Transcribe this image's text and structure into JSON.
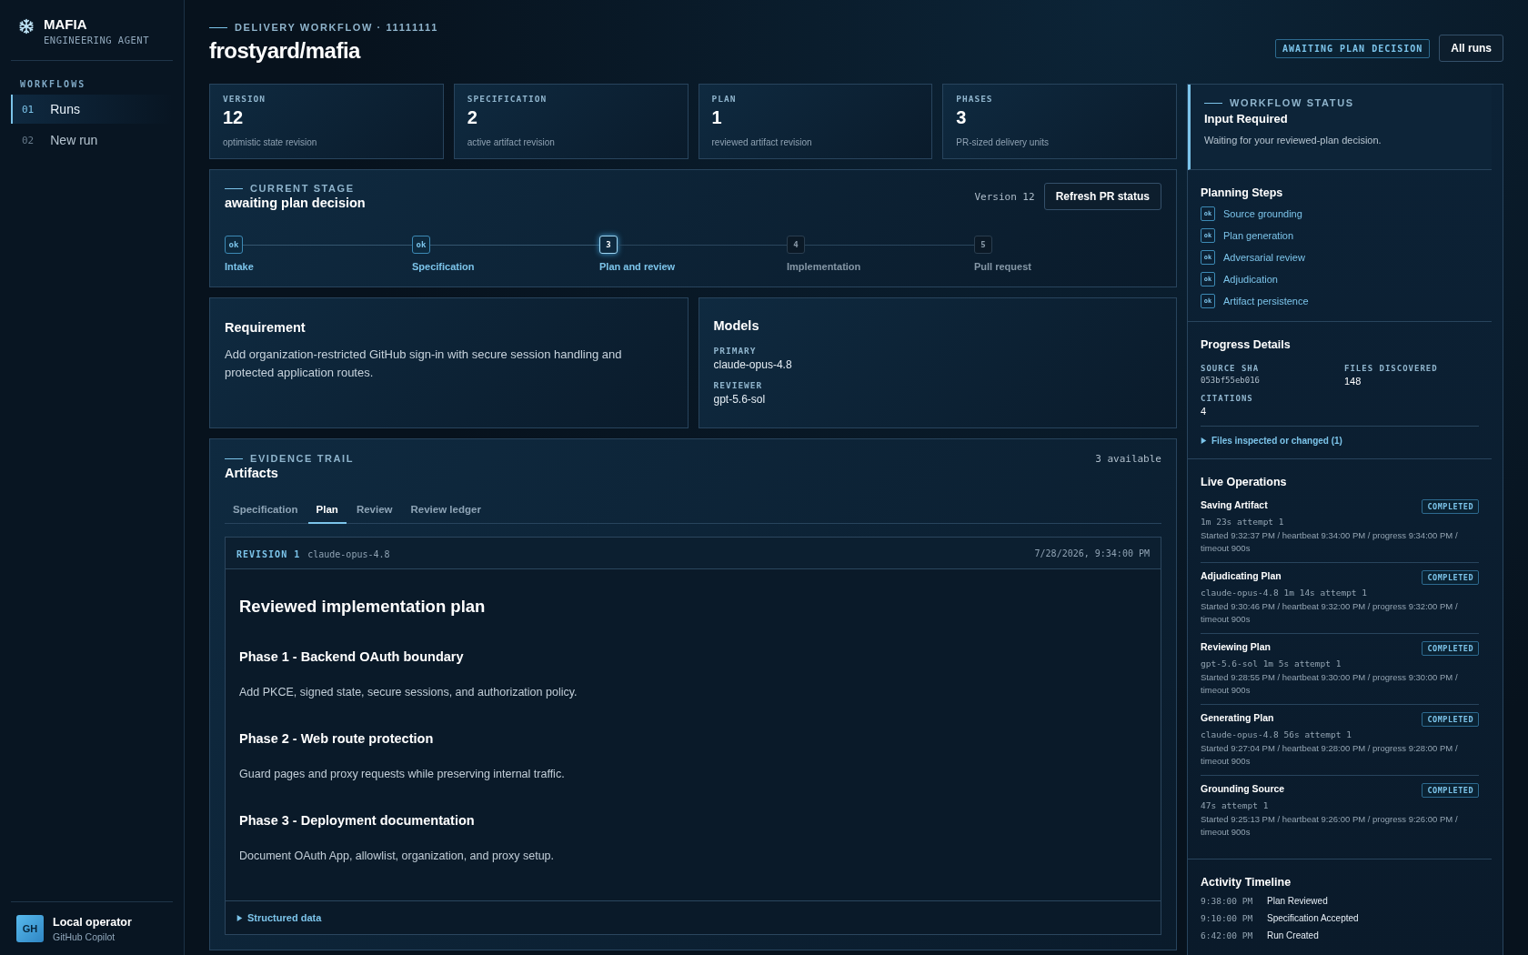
{
  "brand": {
    "name": "MAFIA",
    "subtitle": "ENGINEERING AGENT"
  },
  "sidebar": {
    "section": "WORKFLOWS",
    "items": [
      {
        "number": "01",
        "label": "Runs",
        "selected": true
      },
      {
        "number": "02",
        "label": "New run",
        "selected": false
      }
    ],
    "user": {
      "initials": "GH",
      "name": "Local operator",
      "subtitle": "GitHub Copilot"
    }
  },
  "header": {
    "eyebrow": "DELIVERY WORKFLOW · 11111111",
    "title": "frostyard/mafia",
    "status_badge": "AWAITING PLAN DECISION",
    "button": "All runs"
  },
  "stats": [
    {
      "label": "VERSION",
      "value": "12",
      "caption": "optimistic state revision"
    },
    {
      "label": "SPECIFICATION",
      "value": "2",
      "caption": "active artifact revision"
    },
    {
      "label": "PLAN",
      "value": "1",
      "caption": "reviewed artifact revision"
    },
    {
      "label": "PHASES",
      "value": "3",
      "caption": "PR-sized delivery units"
    }
  ],
  "stage": {
    "eyebrow": "CURRENT STAGE",
    "title": "awaiting plan decision",
    "version": "Version 12",
    "button": "Refresh PR status",
    "steps": [
      {
        "marker": "ok",
        "label": "Intake",
        "completed": true,
        "current": false
      },
      {
        "marker": "ok",
        "label": "Specification",
        "completed": true,
        "current": false
      },
      {
        "marker": "3",
        "label": "Plan and review",
        "completed": false,
        "current": true
      },
      {
        "marker": "4",
        "label": "Implementation",
        "completed": false,
        "current": false
      },
      {
        "marker": "5",
        "label": "Pull request",
        "completed": false,
        "current": false
      }
    ]
  },
  "requirement": {
    "title": "Requirement",
    "text": "Add organization-restricted GitHub sign-in with secure session handling and protected application routes."
  },
  "models": {
    "title": "Models",
    "entries": [
      {
        "label": "PRIMARY",
        "value": "claude-opus-4.8"
      },
      {
        "label": "REVIEWER",
        "value": "gpt-5.6-sol"
      }
    ]
  },
  "artifacts": {
    "eyebrow": "EVIDENCE TRAIL",
    "title": "Artifacts",
    "count": "3 available",
    "tabs": [
      {
        "label": "Specification",
        "selected": false
      },
      {
        "label": "Plan",
        "selected": true
      },
      {
        "label": "Review",
        "selected": false
      },
      {
        "label": "Review ledger",
        "selected": false
      }
    ],
    "revision": {
      "label": "REVISION 1",
      "model": "claude-opus-4.8",
      "date": "7/28/2026, 9:34:00 PM"
    },
    "document": {
      "title": "Reviewed implementation plan",
      "sections": [
        {
          "heading": "Phase 1 - Backend OAuth boundary",
          "text": "Add PKCE, signed state, secure sessions, and authorization policy."
        },
        {
          "heading": "Phase 2 - Web route protection",
          "text": "Guard pages and proxy requests while preserving internal traffic."
        },
        {
          "heading": "Phase 3 - Deployment documentation",
          "text": "Document OAuth App, allowlist, organization, and proxy setup."
        }
      ]
    },
    "structured_data": {
      "label": "Structured data",
      "expanded": false
    }
  },
  "workflow_status": {
    "eyebrow": "WORKFLOW STATUS",
    "title": "Input Required",
    "text": "Waiting for your reviewed-plan decision."
  },
  "planning_steps": {
    "title": "Planning Steps",
    "items": [
      {
        "marker": "ok",
        "label": "Source grounding"
      },
      {
        "marker": "ok",
        "label": "Plan generation"
      },
      {
        "marker": "ok",
        "label": "Adversarial review"
      },
      {
        "marker": "ok",
        "label": "Adjudication"
      },
      {
        "marker": "ok",
        "label": "Artifact persistence"
      }
    ]
  },
  "progress_details": {
    "title": "Progress Details",
    "fields": [
      {
        "label": "SOURCE SHA",
        "value": "053bf55eb016",
        "kind": "mono"
      },
      {
        "label": "FILES DISCOVERED",
        "value": "148",
        "kind": "text"
      },
      {
        "label": "CITATIONS",
        "value": "4",
        "kind": "text"
      }
    ],
    "files": {
      "label": "Files inspected or changed (1)",
      "expanded": false
    }
  },
  "live_operations": {
    "title": "Live Operations",
    "items": [
      {
        "name": "Saving Artifact",
        "status": "COMPLETED",
        "meta": "1m 23s attempt 1",
        "detail": "Started 9:32:37 PM / heartbeat 9:34:00 PM / progress 9:34:00 PM / timeout 900s"
      },
      {
        "name": "Adjudicating Plan",
        "status": "COMPLETED",
        "meta": "claude-opus-4.8 1m 14s attempt 1",
        "detail": "Started 9:30:46 PM / heartbeat 9:32:00 PM / progress 9:32:00 PM / timeout 900s"
      },
      {
        "name": "Reviewing Plan",
        "status": "COMPLETED",
        "meta": "gpt-5.6-sol 1m 5s attempt 1",
        "detail": "Started 9:28:55 PM / heartbeat 9:30:00 PM / progress 9:30:00 PM / timeout 900s"
      },
      {
        "name": "Generating Plan",
        "status": "COMPLETED",
        "meta": "claude-opus-4.8 56s attempt 1",
        "detail": "Started 9:27:04 PM / heartbeat 9:28:00 PM / progress 9:28:00 PM / timeout 900s"
      },
      {
        "name": "Grounding Source",
        "status": "COMPLETED",
        "meta": "47s attempt 1",
        "detail": "Started 9:25:13 PM / heartbeat 9:26:00 PM / progress 9:26:00 PM / timeout 900s"
      }
    ]
  },
  "activity_timeline": {
    "title": "Activity Timeline",
    "items": [
      {
        "time": "9:38:00 PM",
        "event": "Plan Reviewed"
      },
      {
        "time": "9:10:00 PM",
        "event": "Specification Accepted"
      },
      {
        "time": "6:42:00 PM",
        "event": "Run Created"
      }
    ]
  }
}
